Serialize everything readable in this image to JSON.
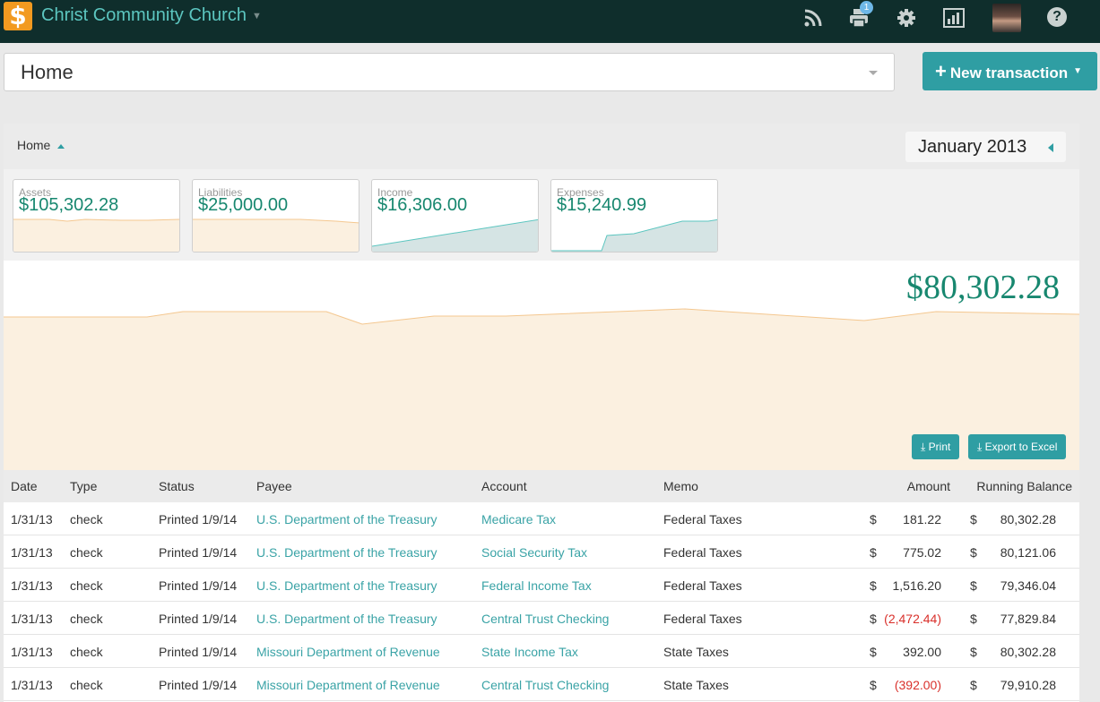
{
  "app": {
    "org_name": "Christ Community Church",
    "logo_glyph": "$",
    "print_badge": "1",
    "help_glyph": "?"
  },
  "page_selector": {
    "value": "Home"
  },
  "new_transaction": {
    "label": "New transaction"
  },
  "panel": {
    "breadcrumb": "Home",
    "period": "January 2013"
  },
  "summary_cards": [
    {
      "label": "Assets",
      "value": "$105,302.28"
    },
    {
      "label": "Liabilities",
      "value": "$25,000.00"
    },
    {
      "label": "Income",
      "value": "$16,306.00"
    },
    {
      "label": "Expenses",
      "value": "$15,240.99"
    }
  ],
  "balance": {
    "value": "$80,302.28"
  },
  "actions": {
    "print": "Print",
    "export": "Export to Excel"
  },
  "table": {
    "columns": [
      "Date",
      "Type",
      "Status",
      "Payee",
      "Account",
      "Memo",
      "Amount",
      "Running Balance"
    ],
    "currency_symbol": "$",
    "rows": [
      {
        "date": "1/31/13",
        "type": "check",
        "status": "Printed 1/9/14",
        "payee": "U.S. Department of the Treasury",
        "account": "Medicare Tax",
        "memo": "Federal Taxes",
        "amount": "181.22",
        "negative": false,
        "balance": "80,302.28"
      },
      {
        "date": "1/31/13",
        "type": "check",
        "status": "Printed 1/9/14",
        "payee": "U.S. Department of the Treasury",
        "account": "Social Security Tax",
        "memo": "Federal Taxes",
        "amount": "775.02",
        "negative": false,
        "balance": "80,121.06"
      },
      {
        "date": "1/31/13",
        "type": "check",
        "status": "Printed 1/9/14",
        "payee": "U.S. Department of the Treasury",
        "account": "Federal Income Tax",
        "memo": "Federal Taxes",
        "amount": "1,516.20",
        "negative": false,
        "balance": "79,346.04"
      },
      {
        "date": "1/31/13",
        "type": "check",
        "status": "Printed 1/9/14",
        "payee": "U.S. Department of the Treasury",
        "account": "Central Trust Checking",
        "memo": "Federal Taxes",
        "amount": "(2,472.44)",
        "negative": true,
        "balance": "77,829.84"
      },
      {
        "date": "1/31/13",
        "type": "check",
        "status": "Printed 1/9/14",
        "payee": "Missouri Department of Revenue",
        "account": "State Income Tax",
        "memo": "State Taxes",
        "amount": "392.00",
        "negative": false,
        "balance": "80,302.28"
      },
      {
        "date": "1/31/13",
        "type": "check",
        "status": "Printed 1/9/14",
        "payee": "Missouri Department of Revenue",
        "account": "Central Trust Checking",
        "memo": "State Taxes",
        "amount": "(392.00)",
        "negative": true,
        "balance": "79,910.28"
      }
    ]
  },
  "colors": {
    "topbar": "#0f2e2c",
    "accent": "#2f9ea3",
    "money_green": "#17876f",
    "negative_red": "#d9302b",
    "asset_fill": "#fbf0e0",
    "income_fill": "#d5e4e4"
  },
  "icons": {
    "topbar": [
      "rss-icon",
      "print-icon",
      "gear-icon",
      "reports-icon",
      "avatar",
      "help-icon"
    ],
    "buttons": [
      "download-icon"
    ]
  }
}
